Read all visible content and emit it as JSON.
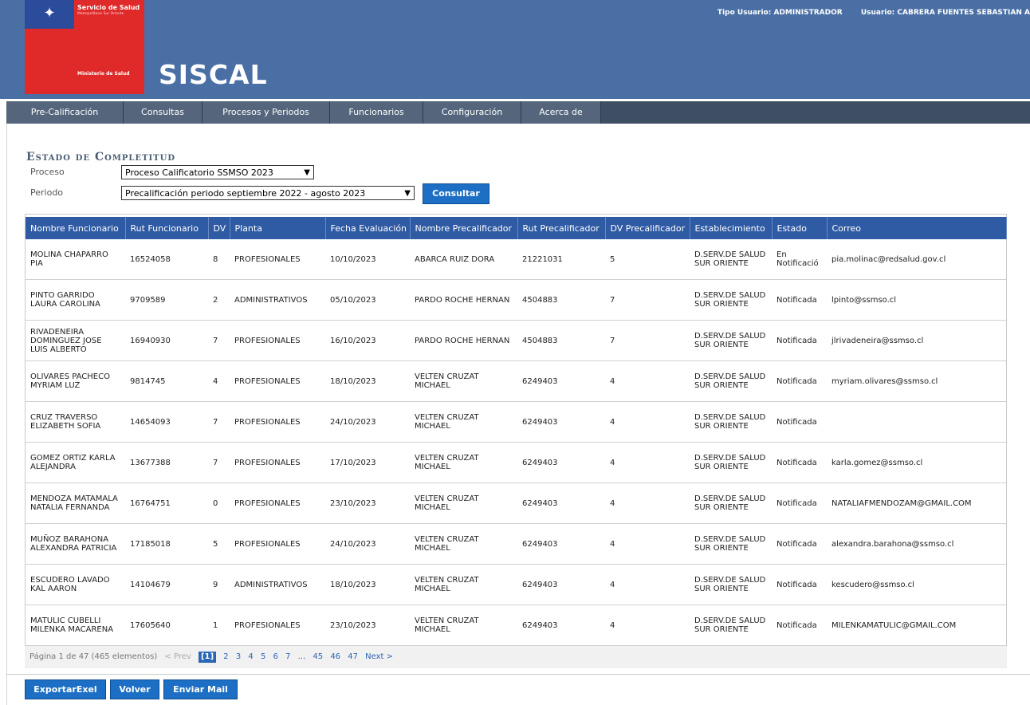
{
  "header": {
    "logo_line1": "Servicio de Salud",
    "logo_line2": "Metropolitano Sur Oriente",
    "logo_line3": "Ministerio de Salud",
    "app_title": "SISCAL",
    "user_type": "Tipo Usuario: ADMINISTRADOR",
    "user_name": "Usuario: CABRERA FUENTES SEBASTIAN A"
  },
  "nav": [
    "Pre-Calificación",
    "Consultas",
    "Procesos y Periodos",
    "Funcionarios",
    "Configuración",
    "Acerca de"
  ],
  "form": {
    "title": "Estado de Completitud",
    "proceso_label": "Proceso",
    "proceso_value": "Proceso Calificatorio SSMSO 2023",
    "periodo_label": "Periodo",
    "periodo_value": "Precalificación periodo septiembre 2022 - agosto 2023",
    "consultar": "Consultar"
  },
  "table": {
    "columns": [
      "Nombre Funcionario",
      "Rut Funcionario",
      "DV",
      "Planta",
      "Fecha Evaluación",
      "Nombre Precalificador",
      "Rut Precalificador",
      "DV Precalificador",
      "Establecimiento",
      "Estado",
      "Correo"
    ],
    "rows": [
      [
        "MOLINA CHAPARRO PIA",
        "16524058",
        "8",
        "PROFESIONALES",
        "10/10/2023",
        "ABARCA RUIZ DORA",
        "21221031",
        "5",
        "D.SERV.DE SALUD SUR ORIENTE",
        "En Notificació",
        "pia.molinac@redsalud.gov.cl"
      ],
      [
        "PINTO GARRIDO LAURA CAROLINA",
        "9709589",
        "2",
        "ADMINISTRATIVOS",
        "05/10/2023",
        "PARDO ROCHE HERNAN",
        "4504883",
        "7",
        "D.SERV.DE SALUD SUR ORIENTE",
        "Notificada",
        "lpinto@ssmso.cl"
      ],
      [
        "RIVADENEIRA DOMINGUEZ JOSE LUIS ALBERTO",
        "16940930",
        "7",
        "PROFESIONALES",
        "16/10/2023",
        "PARDO ROCHE HERNAN",
        "4504883",
        "7",
        "D.SERV.DE SALUD SUR ORIENTE",
        "Notificada",
        "jlrivadeneira@ssmso.cl"
      ],
      [
        "OLIVARES PACHECO MYRIAM LUZ",
        "9814745",
        "4",
        "PROFESIONALES",
        "18/10/2023",
        "VELTEN CRUZAT MICHAEL",
        "6249403",
        "4",
        "D.SERV.DE SALUD SUR ORIENTE",
        "Notificada",
        "myriam.olivares@ssmso.cl"
      ],
      [
        "CRUZ TRAVERSO ELIZABETH SOFIA",
        "14654093",
        "7",
        "PROFESIONALES",
        "24/10/2023",
        "VELTEN CRUZAT MICHAEL",
        "6249403",
        "4",
        "D.SERV.DE SALUD SUR ORIENTE",
        "Notificada",
        ""
      ],
      [
        "GOMEZ ORTIZ KARLA ALEJANDRA",
        "13677388",
        "7",
        "PROFESIONALES",
        "17/10/2023",
        "VELTEN CRUZAT MICHAEL",
        "6249403",
        "4",
        "D.SERV.DE SALUD SUR ORIENTE",
        "Notificada",
        "karla.gomez@ssmso.cl"
      ],
      [
        "MENDOZA MATAMALA NATALIA FERNANDA",
        "16764751",
        "0",
        "PROFESIONALES",
        "23/10/2023",
        "VELTEN CRUZAT MICHAEL",
        "6249403",
        "4",
        "D.SERV.DE SALUD SUR ORIENTE",
        "Notificada",
        "NATALIAFMENDOZAM@GMAIL.COM"
      ],
      [
        "MUÑOZ BARAHONA ALEXANDRA PATRICIA",
        "17185018",
        "5",
        "PROFESIONALES",
        "24/10/2023",
        "VELTEN CRUZAT MICHAEL",
        "6249403",
        "4",
        "D.SERV.DE SALUD SUR ORIENTE",
        "Notificada",
        "alexandra.barahona@ssmso.cl"
      ],
      [
        "ESCUDERO LAVADO KAL AARON",
        "14104679",
        "9",
        "ADMINISTRATIVOS",
        "18/10/2023",
        "VELTEN CRUZAT MICHAEL",
        "6249403",
        "4",
        "D.SERV.DE SALUD SUR ORIENTE",
        "Notificada",
        "kescudero@ssmso.cl"
      ],
      [
        "MATULIC CUBELLI MILENKA MACARENA",
        "17605640",
        "1",
        "PROFESIONALES",
        "23/10/2023",
        "VELTEN CRUZAT MICHAEL",
        "6249403",
        "4",
        "D.SERV.DE SALUD SUR ORIENTE",
        "Notificada",
        "MILENKAMATULIC@GMAIL.COM"
      ]
    ]
  },
  "pager": {
    "info": "Página 1 de 47 (465 elementos)",
    "prev": "< Prev",
    "current": "[1]",
    "pages": [
      "2",
      "3",
      "4",
      "5",
      "6",
      "7",
      "...",
      "45",
      "46",
      "47"
    ],
    "next": "Next >"
  },
  "buttons": {
    "export": "ExportarExel",
    "back": "Volver",
    "mail": "Enviar Mail"
  }
}
